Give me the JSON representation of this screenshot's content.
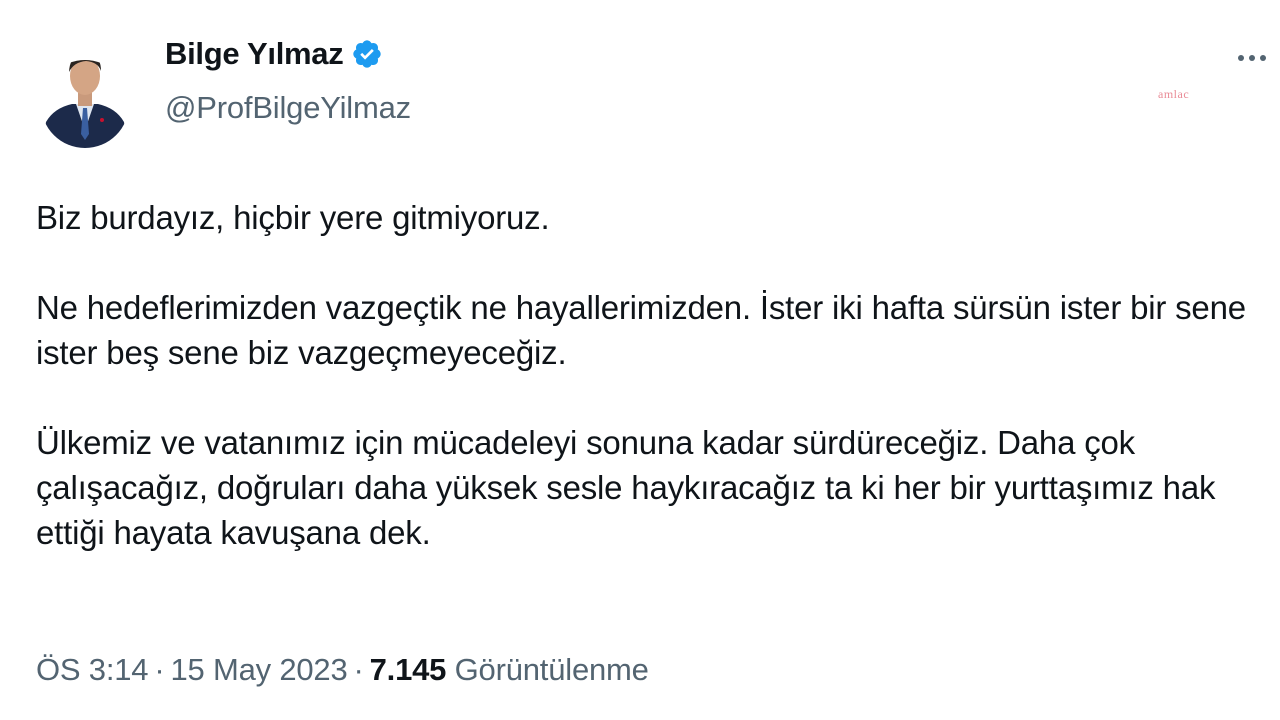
{
  "tweet": {
    "author": {
      "display_name": "Bilge Yılmaz",
      "handle": "@ProfBilgeYilmaz",
      "verified": true,
      "verified_icon": "verified-badge-icon",
      "avatar_icon": "profile-photo"
    },
    "menu_icon": "more-options-icon",
    "watermark": "amlac",
    "paragraphs": [
      "Biz burdayız, hiçbir yere gitmiyoruz.",
      "Ne hedeflerimizden vazgeçtik ne hayallerimizden. İster iki hafta sürsün ister bir sene ister beş sene biz vazgeçmeyeceğiz.",
      "Ülkemiz ve vatanımız için mücadeleyi sonuna kadar sürdüreceğiz. Daha çok çalışacağız, doğruları daha yüksek sesle haykıracağız ta ki her bir yurttaşımız hak ettiği hayata kavuşana dek."
    ],
    "meta": {
      "time": "ÖS 3:14",
      "separator": "·",
      "date": "15 May 2023",
      "views_count": "7.145",
      "views_label": "Görüntülenme"
    }
  },
  "colors": {
    "text_primary": "#0f1419",
    "text_secondary": "#536471",
    "verified_blue": "#1d9bf0"
  }
}
